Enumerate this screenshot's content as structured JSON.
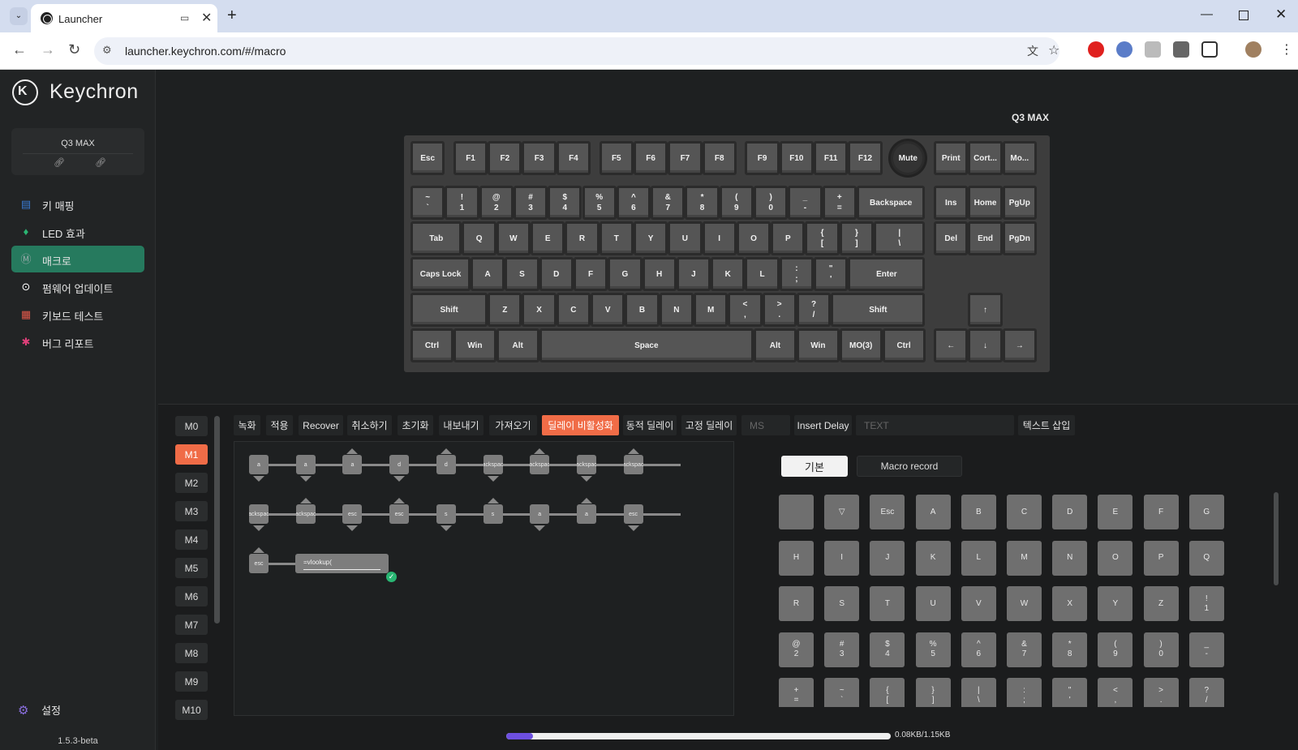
{
  "browser": {
    "tab_title": "Launcher",
    "url": "launcher.keychron.com/#/macro",
    "new_tab": "+",
    "tab_close": "✕"
  },
  "sidebar": {
    "brand": "Keychron",
    "device_name": "Q3 MAX",
    "items": [
      {
        "label": "키 매핑",
        "icon": "keyboard-icon",
        "color": "#3a7bd5",
        "active": false
      },
      {
        "label": "LED 효과",
        "icon": "bulb-icon",
        "color": "#2bb673",
        "active": false
      },
      {
        "label": "매크로",
        "icon": "macro-icon",
        "color": "#9aa",
        "active": true
      },
      {
        "label": "펌웨어 업데이트",
        "icon": "update-icon",
        "color": "#ffffff",
        "active": false
      },
      {
        "label": "키보드 테스트",
        "icon": "test-icon",
        "color": "#e0584a",
        "active": false
      },
      {
        "label": "버그 리포트",
        "icon": "bug-icon",
        "color": "#e0407a",
        "active": false
      }
    ],
    "settings": "설정",
    "version": "1.5.3-beta"
  },
  "keyboard": {
    "name": "Q3 MAX",
    "rows": [
      [
        "Esc",
        "F1",
        "F2",
        "F3",
        "F4",
        "F5",
        "F6",
        "F7",
        "F8",
        "F9",
        "F10",
        "F11",
        "F12",
        "Mute",
        "Print",
        "Cort...",
        "Mo..."
      ],
      [
        "~\n`",
        "!\n1",
        "@\n2",
        "#\n3",
        "$\n4",
        "%\n5",
        "^\n6",
        "&\n7",
        "*\n8",
        "(\n9",
        ")\n0",
        "_\n-",
        "+\n=",
        "Backspace",
        "Ins",
        "Home",
        "PgUp"
      ],
      [
        "Tab",
        "Q",
        "W",
        "E",
        "R",
        "T",
        "Y",
        "U",
        "I",
        "O",
        "P",
        "{\n[",
        "}\n]",
        "|\n\\",
        "Del",
        "End",
        "PgDn"
      ],
      [
        "Caps Lock",
        "A",
        "S",
        "D",
        "F",
        "G",
        "H",
        "J",
        "K",
        "L",
        ":\n;",
        "\"\n'",
        "Enter"
      ],
      [
        "Shift",
        "Z",
        "X",
        "C",
        "V",
        "B",
        "N",
        "M",
        "<\n,",
        ">\n.",
        "?\n/",
        "Shift",
        "↑"
      ],
      [
        "Ctrl",
        "Win",
        "Alt",
        "Space",
        "Alt",
        "Win",
        "MO(3)",
        "Ctrl",
        "←",
        "↓",
        "→"
      ]
    ]
  },
  "macro": {
    "slots": [
      "M0",
      "M1",
      "M2",
      "M3",
      "M4",
      "M5",
      "M6",
      "M7",
      "M8",
      "M9",
      "M10"
    ],
    "active_slot": "M1",
    "toolbar": {
      "record": "녹화",
      "apply": "적용",
      "recover": "Recover",
      "cancel": "취소하기",
      "reset": "초기화",
      "export": "내보내기",
      "import": "가져오기",
      "disable_delay": "딜레이 비활성화",
      "dynamic_delay": "동적 딜레이",
      "fixed_delay": "고정 딜레이",
      "ms_placeholder": "MS",
      "insert_delay": "Insert Delay",
      "text_placeholder": "TEXT",
      "insert_text": "텍스트 삽입"
    },
    "sequence_rows": [
      [
        {
          "k": "a",
          "d": "dn"
        },
        {
          "k": "a",
          "d": "dn"
        },
        {
          "k": "a",
          "d": "up"
        },
        {
          "k": "d",
          "d": "dn"
        },
        {
          "k": "d",
          "d": "up"
        },
        {
          "k": "backspace",
          "d": "dn"
        },
        {
          "k": "backspace",
          "d": "up"
        },
        {
          "k": "backspace",
          "d": "dn"
        },
        {
          "k": "backspace",
          "d": "up"
        }
      ],
      [
        {
          "k": "backspace",
          "d": "dn"
        },
        {
          "k": "backspace",
          "d": "up"
        },
        {
          "k": "esc",
          "d": "dn"
        },
        {
          "k": "esc",
          "d": "up"
        },
        {
          "k": "s",
          "d": "dn"
        },
        {
          "k": "s",
          "d": "up"
        },
        {
          "k": "a",
          "d": "dn"
        },
        {
          "k": "a",
          "d": "up"
        },
        {
          "k": "esc",
          "d": "dn"
        }
      ],
      [
        {
          "k": "esc",
          "d": "up"
        }
      ]
    ],
    "text_node": "=vlookup(",
    "tabs": {
      "basic": "기본",
      "macro_record": "Macro record"
    },
    "palette": [
      "",
      "▽",
      "Esc",
      "A",
      "B",
      "C",
      "D",
      "E",
      "F",
      "G",
      "H",
      "I",
      "J",
      "K",
      "L",
      "M",
      "N",
      "O",
      "P",
      "Q",
      "R",
      "S",
      "T",
      "U",
      "V",
      "W",
      "X",
      "Y",
      "Z",
      "!\n1",
      "@\n2",
      "#\n3",
      "$\n4",
      "%\n5",
      "^\n6",
      "&\n7",
      "*\n8",
      "(\n9",
      ")\n0",
      "_\n-",
      "+\n=",
      "~\n`",
      "{\n[",
      "}\n]",
      "|\n\\",
      ":\n;",
      "\"\n'",
      "<\n,",
      ">\n.",
      "?\n/"
    ],
    "memory": {
      "used_fraction": 0.07,
      "label": "0.08KB/1.15KB"
    }
  }
}
